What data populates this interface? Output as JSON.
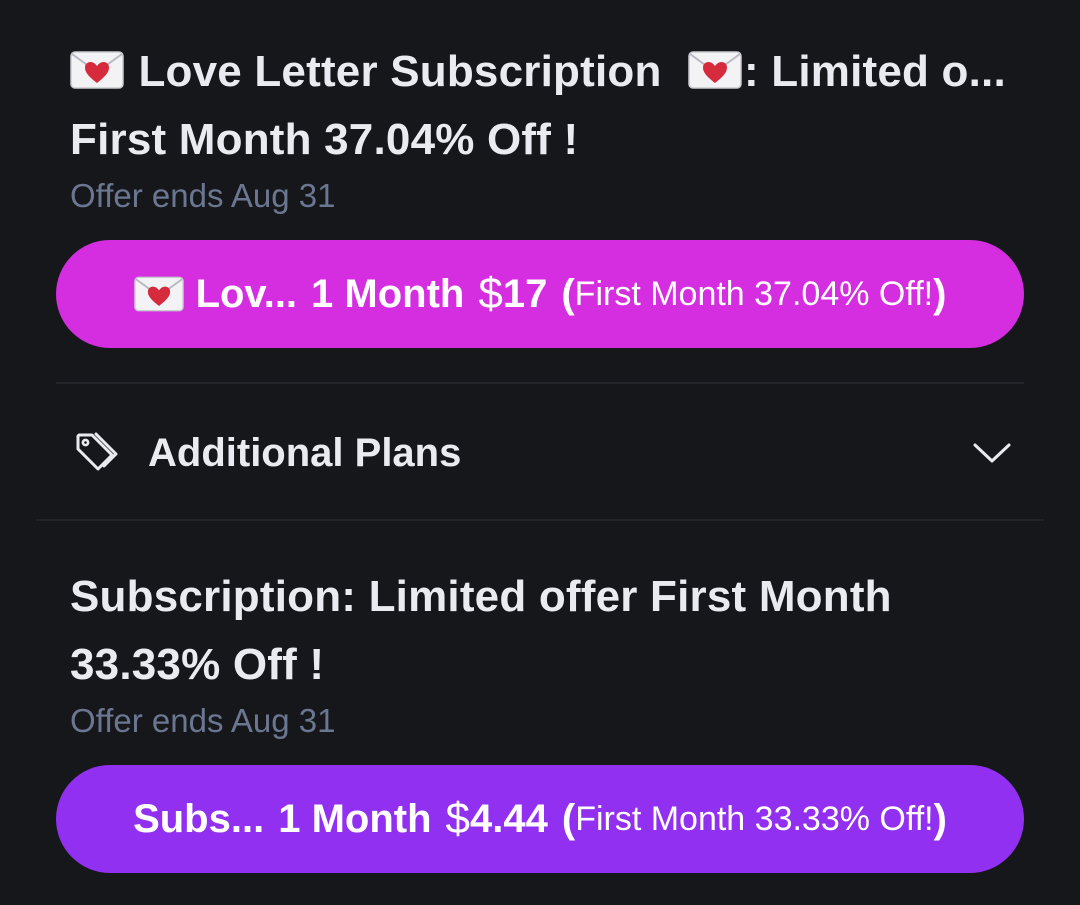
{
  "offers": [
    {
      "title_prefix_icon": "love-letter-icon",
      "title_line1": "Love Letter Subscription",
      "title_mid_icon": "love-letter-icon",
      "title_line1_tail": ": Limited o...",
      "title_line2": "First Month 37.04% Off !",
      "expiry": "Offer ends Aug 31",
      "button": {
        "icon": "love-letter-icon",
        "name": "Lov...",
        "period": "1 Month",
        "currency": "$",
        "amount": "17",
        "paren_open": "(",
        "note": "First Month 37.04% Off!",
        "paren_close": ")",
        "color": "#d52de0"
      }
    },
    {
      "title_line1": "Subscription: Limited offer First Month",
      "title_line2": "33.33% Off !",
      "expiry": "Offer ends Aug 31",
      "button": {
        "name": "Subs...",
        "period": "1 Month",
        "currency": "$",
        "amount": "4.44",
        "paren_open": "(",
        "note": "First Month 33.33% Off!",
        "paren_close": ")",
        "color": "#9230f2"
      }
    }
  ],
  "additional_plans": {
    "label": "Additional Plans",
    "icon": "tag-icon",
    "toggle_icon": "chevron-down-icon"
  },
  "colors": {
    "background": "#16171b",
    "title_text": "#e9ebf0",
    "muted_text": "#6b7791",
    "divider": "#23252b"
  }
}
